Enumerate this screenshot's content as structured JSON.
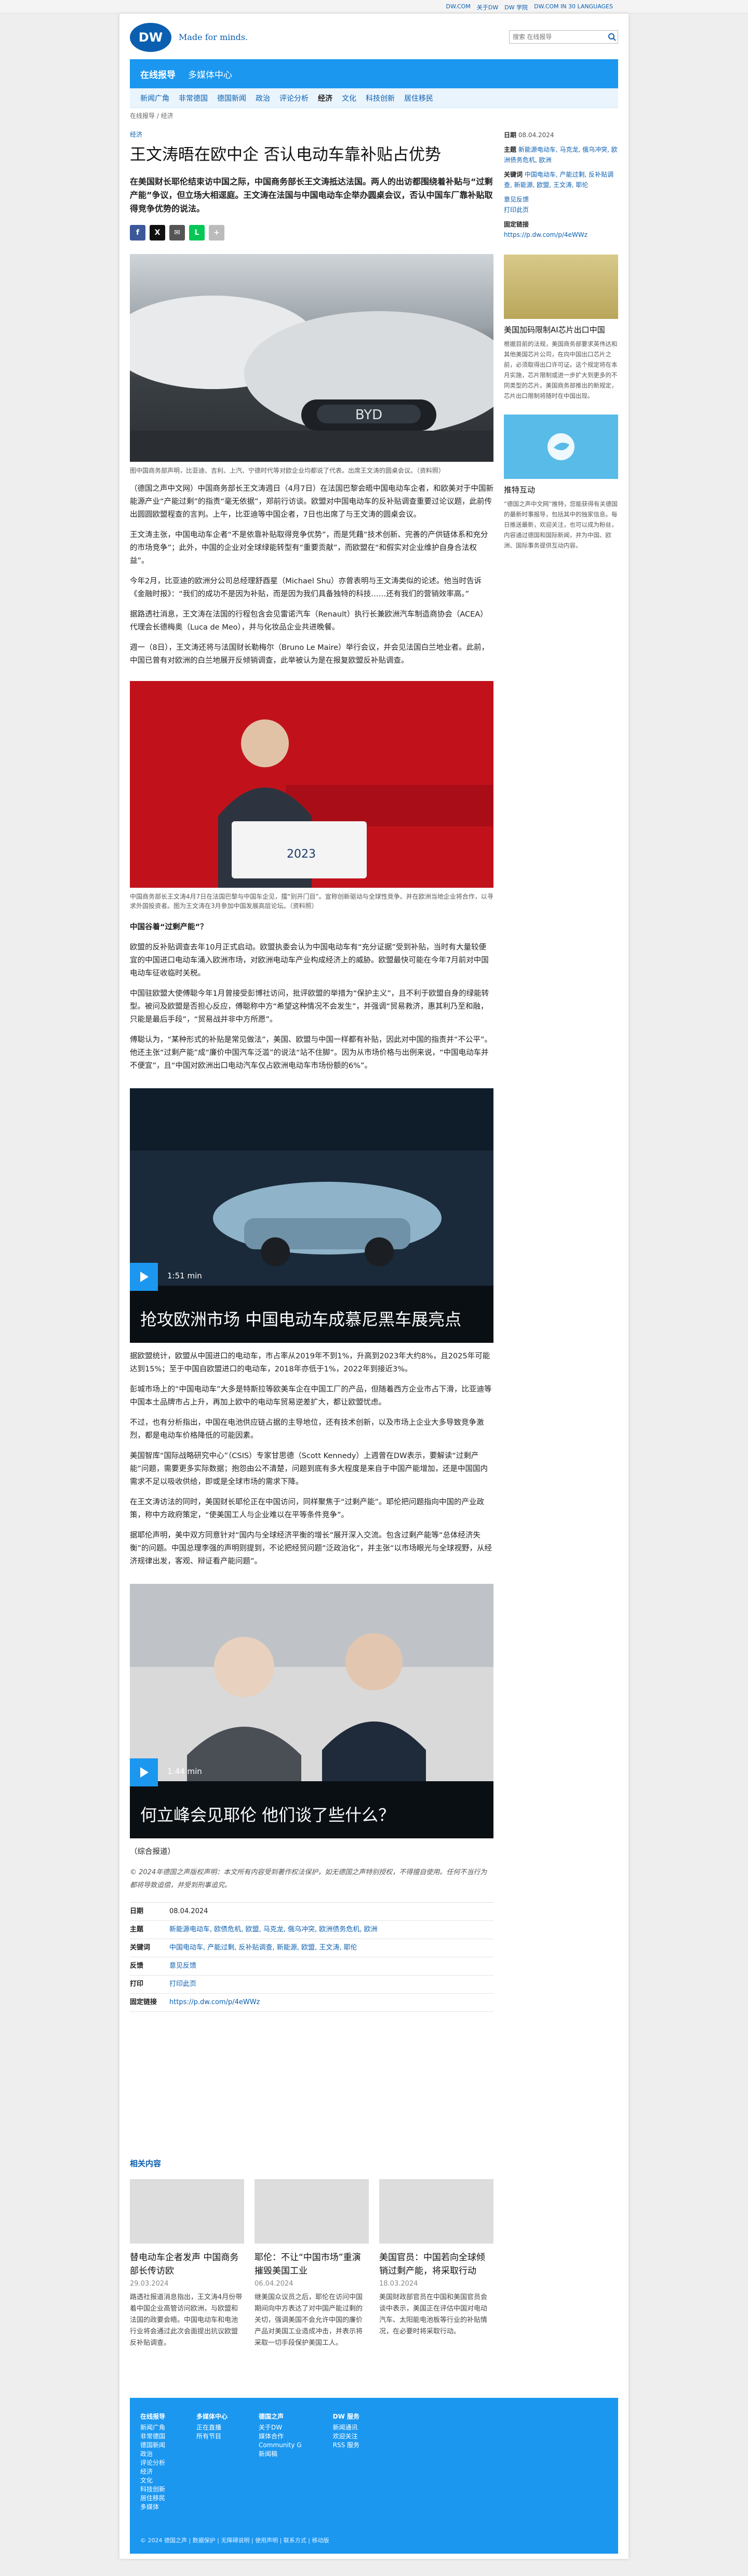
{
  "topbar": {
    "links": [
      "DW.COM",
      "关于DW",
      "DW 学院",
      "DW.COM IN 30 LANGUAGES"
    ]
  },
  "header": {
    "logo": "DW",
    "tagline": "Made for minds.",
    "search_placeholder": "搜索 在线报导"
  },
  "nav": {
    "primary": [
      "在线报导",
      "多媒体中心"
    ],
    "secondary": [
      "新闻广角",
      "非常德国",
      "德国新闻",
      "政治",
      "评论分析",
      "经济",
      "文化",
      "科技创新",
      "居住移民"
    ],
    "active": "经济"
  },
  "breadcrumb": "在线报导 / 经济",
  "article": {
    "kicker": "经济",
    "title": "王文涛晤在欧中企 否认电动车靠补贴占优势",
    "lead": "在美国财长耶伦结束访中国之际，中国商务部长王文涛抵达法国。两人的出访都围绕着补贴与“过剩产能”争议，但立场大相逕庭。王文涛在法国与中国电动车企举办圆桌会议，否认中国车厂靠补贴取得竞争优势的说法。",
    "share": [
      "f",
      "X",
      "✉",
      "L",
      "+"
    ],
    "photo1_caption": "图中国商务部声明，比亚迪、吉利、上汽、宁德时代等对欧企业均都说了代表。出席王文涛的圆桌会议。（资料照）",
    "p1": "（德国之声中文网）中国商务部长王文涛週日（4月7日）在法国巴黎会晤中国电动车企者，和欧美对于中国新能源产业“产能过剩”的指责“毫无依据”，郑前行访谈。欧盟对中国电动车的反补贴调查重要过论议题，此前传出圆圆欧盟程查的言判。上午，比亚迪等中国企者，7日也出席了与王文涛的圆桌会议。",
    "p2": "王文涛主张，中国电动车企者“不是依靠补贴取得竞争优势”，而是凭藉“技术创新、完善的产供链体系和充分的市场竞争”；此外，中国的企业对全球绿能转型有“重要贡献”，而欧盟在“和假实对企业维护自身合法权益”。",
    "p3": "今年2月，比亚迪的欧洲分公司总经理舒酉星（Michael Shu）亦曾表明与王文涛类似的论述。他当时告诉《金融时报》：“我们的成功不是因为补贴，而是因为我们具备独特的科技……还有我们的营销效率高。”",
    "p4": "据路透社消息，王文涛在法国的行程包含会见雷诺汽车（Renault）执行长兼欧洲汽车制造商协会（ACEA）代理会长德梅奥（Luca de Meo），并与化妆品企业共进晚餐。",
    "p5": "週一（8日），王文涛还将与法国财长勒梅尔（Bruno Le Maire）举行会议，并会见法国白兰地业者。此前，中国已曾有对欧洲的白兰地展开反倾销调查，此举被认为是在报复欧盟反补贴调查。",
    "photo2_caption": "中国商务部长王文涛4月7日在法国巴黎与中国车企见，擂“别开门目”。宣称创新驱动与全球性竞争。并在欧洲当地企业将合作，以寻求外国投资者。图为王文涛在3月參加中国发展高层论坛。（资料照）",
    "h1": "中国谷着“过剩产能”？",
    "p6": "欧盟的反补贴调查去年10月正式启动。欧盟执委会认为中国电动车有“充分证据”受到补贴，当时有大量较便宜的中国进口电动车涌入欧洲市场，对欧洲电动车产业构成经济上的威胁。欧盟最快可能在今年7月前对中国电动车征收临时关税。",
    "p7": "中国驻欧盟大使傅聪今年1月曾接受彭博社访问，批评欧盟的举措为“保护主义”，且不利于欧盟自身的绿能转型。被问及欧盟是否担心反应，傅聪称中方“希望这种情况不会发生”，并强调“贸易救济，惠其利乃至和融，只能是最后手段”，“贸易战并非中方所愿”。",
    "p8": "傅聪认为，“某种形式的补贴是常见做法”，美国、欧盟与中国一样都有补贴，因此对中国的指责并“不公平”。他还主张“过剩产能”成“廉价中国汽车泛滥”的说法“站不住脚”。因为从市场价格与出例来说，“中国电动车并不便宜”，且“中国对欧洲出口电动汽车仅占欧洲电动车市场份额的6%”。",
    "video1": {
      "duration": "1:51 min",
      "title": "抢攻欧洲市场 中国电动车成慕尼黑车展亮点"
    },
    "p9": "据欧盟统计，欧盟从中国进口的电动车，市占率从2019年不到1%，升高到2023年大约8%，且2025年可能达到15%；至于中国自欧盟进口的电动车，2018年亦低于1%，2022年到接近3%。",
    "p10": "彭城市场上的“中国电动车”大多是特斯拉等欧美车企在中国工厂的产品，但随着西方企业市占下滑，比亚迪等中国本土品牌市占上升，再加上欧中的电动车贸易逆差扩大，都让欧盟忧虑。",
    "p11": "不过，也有分析指出，中国在电池供应链占据的主导地位，还有技术创新，以及市场上企业大多导致竞争激烈，都是电动车价格降低的可能因素。",
    "p12": "美国智库“国际战略研究中心”（CSIS）专家甘思德（Scott Kennedy）上週曾在DW表示，要解读“过剩产能”问题，需要更多实际数据；抱怨由公不清楚，问题到底有多大程度是来自于中国产能增加，还是中国国内需求不足以吸收供给，即或是全球市场的需求下降。",
    "p13": "在王文涛访法的同时，美国财长耶伦正在中国访问，同样聚焦于“过剩产能”。耶伦把问题指向中国的产业政策，称中方政府策定，“使美国工人与企业难以在平等条件竞争”。",
    "p14": "据耶伦声明，美中双方同意针对“国内与全球经济平衡的增长”展开深入交流。包含过剩产能等“总体经济失衡”的问题。中国总理李强的声明则提到，不论把经贸问题“泛政治化”，并主张“以市场眼光与全球视野，从经济规律出发，客观、辩证看产能问题”。",
    "video2": {
      "duration": "1:44 min",
      "title": "何立峰会见耶伦 他们谈了些什么？"
    },
    "sources": "（综合报道）",
    "copyright": "© 2024年德国之声版权声明：本文所有内容受到著作权法保护，如无德国之声特别授权，不得擅自使用。任何不当行为都将导致追偿，并受到刑事追究。",
    "meta": [
      {
        "k": "日期",
        "v": "08.04.2024"
      },
      {
        "k": "主题",
        "v": "新能源电动车, 欧债危机, 欧盟, 马克龙, 俄乌冲突, 欧洲债务危机, 欧洲"
      },
      {
        "k": "关键词",
        "v": "中国电动车, 产能过剩, 反补贴调查, 新能源, 欧盟, 王文涛, 耶伦"
      },
      {
        "k": "反馈",
        "v": "意见反馈"
      },
      {
        "k": "打印",
        "v": "打印此页"
      },
      {
        "k": "固定链接",
        "v": "https://p.dw.com/p/4eWWz"
      }
    ]
  },
  "aside": {
    "date_label": "日期",
    "date": "08.04.2024",
    "topic_label": "主题",
    "topics": "新能源电动车, 马克龙, 俄乌冲突, 欧洲债务危机, 欧洲",
    "keyword_label": "关键词",
    "keywords": "中国电动车, 产能过剩, 反补贴调查, 新能源, 欧盟, 王文涛, 耶伦",
    "feedback": "意见反馈",
    "print": "打印此页",
    "permalink_label": "固定链接",
    "permalink": "https://p.dw.com/p/4eWWz",
    "promo_title": "美国加码限制AI芯片出口中国",
    "promo_text": "根据目前的法规，美国商务部要求英伟达和其他美国芯片公司，在向中国出口芯片之前，必须取得出口许可证。这个规定将在本月实施，芯片限制或进一步扩大到更多的不同类型的芯片。美国商务部推出的新规定，芯片出口限制将随时在中国出现。",
    "twitter_title": "推特互动",
    "twitter_text": "“德国之声中文网”推特，您能获得有关德国的最新时事报导，包括其中的独家信息。每日推送最新，欢迎关注，也可以成为粉丝，内容通过德国和国际新闻，并为中国、欧洲、国际事务提供互动内容。"
  },
  "related": {
    "title": "相关内容",
    "cards": [
      {
        "title": "替电动车企者发声 中国商务部长传访欧",
        "date": "29.03.2024",
        "text": "路透社报道消息指出，王文涛4月份带着中国企业高管访问欧洲，与欧盟和法国的政要会晤。中国电动车和电池行业将会通过此次会面提出抗议欧盟反补贴调查。"
      },
      {
        "title": "耶伦：不让“中国市场”重演 摧毁美国工业",
        "date": "06.04.2024",
        "text": "继美国众议员之后，耶伦在访问中国期间向中方表达了对中国产能过剩的关切，强调美国不会允许中国的廉价产品对美国工业造成冲击，并表示将采取一切手段保护美国工人。"
      },
      {
        "title": "美国官员：中国若向全球倾销过剩产能，将采取行动",
        "date": "18.03.2024",
        "text": "美国财政部官员在中国和美国官员会谈中表示，美国正在评估中国对电动汽车、太阳能电池板等行业的补贴情况，在必要时将采取行动。"
      }
    ]
  },
  "footer": {
    "cols": [
      {
        "hd": "在线报导",
        "items": [
          "新闻广角",
          "非常德国",
          "德国新闻",
          "政治",
          "评论分析",
          "经济",
          "文化",
          "科技创新",
          "居住移民",
          "多媒体"
        ]
      },
      {
        "hd": "多媒体中心",
        "items": [
          "正在直播",
          "所有节目"
        ]
      },
      {
        "hd": "德国之声",
        "items": [
          "关于DW",
          "媒体合作",
          "Community G",
          "新闻稿"
        ]
      },
      {
        "hd": "DW 服务",
        "items": [
          "新闻通讯",
          "欢迎关注",
          "RSS 服务"
        ]
      }
    ],
    "bottom": "© 2024 德国之声 | 数据保护 | 无障碍说明 | 使用声明 | 联系方式 | 移动版"
  },
  "colors": {
    "accent": "#1b97f0",
    "link": "#0b5fb0"
  }
}
